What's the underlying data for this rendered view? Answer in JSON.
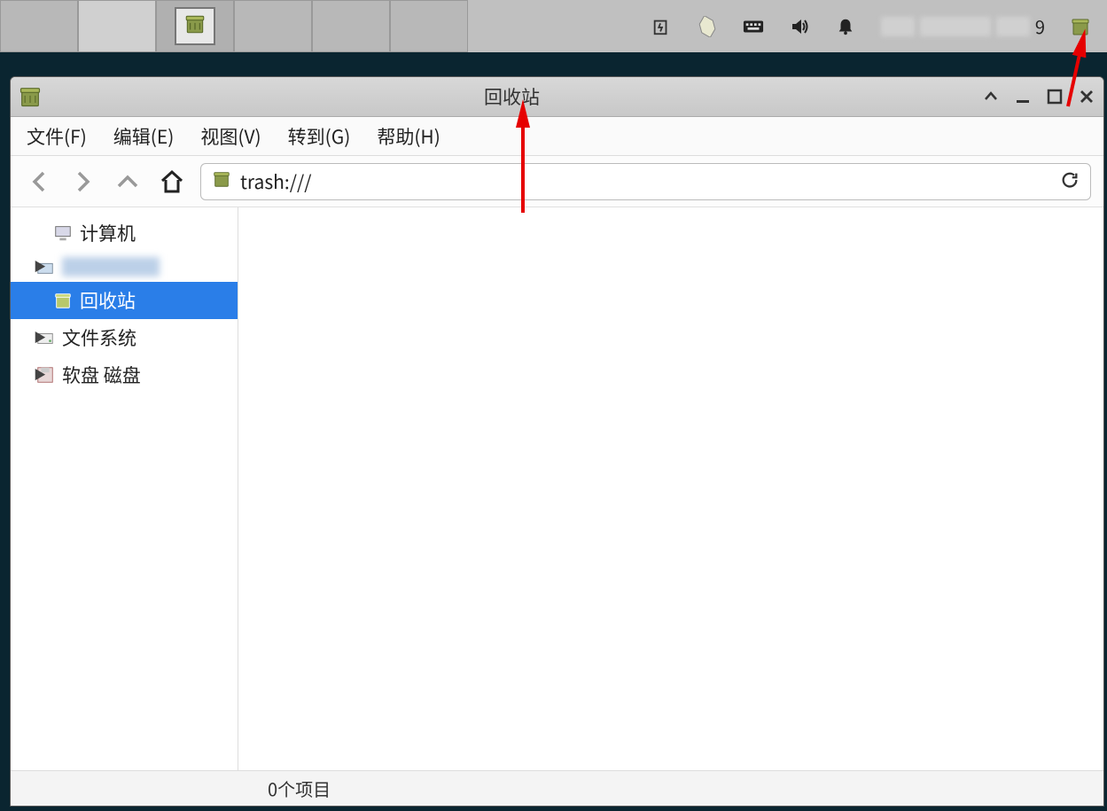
{
  "panel": {
    "tray_number": "9"
  },
  "window": {
    "title": "回收站",
    "menu": {
      "file": "文件(F)",
      "edit": "编辑(E)",
      "view": "视图(V)",
      "go": "转到(G)",
      "help": "帮助(H)"
    },
    "address": "trash:///",
    "sidebar": {
      "computer": "计算机",
      "home_blurred": "",
      "trash": "回收站",
      "filesystem": "文件系统",
      "floppy": "软盘 磁盘"
    },
    "status": "0个项目"
  }
}
